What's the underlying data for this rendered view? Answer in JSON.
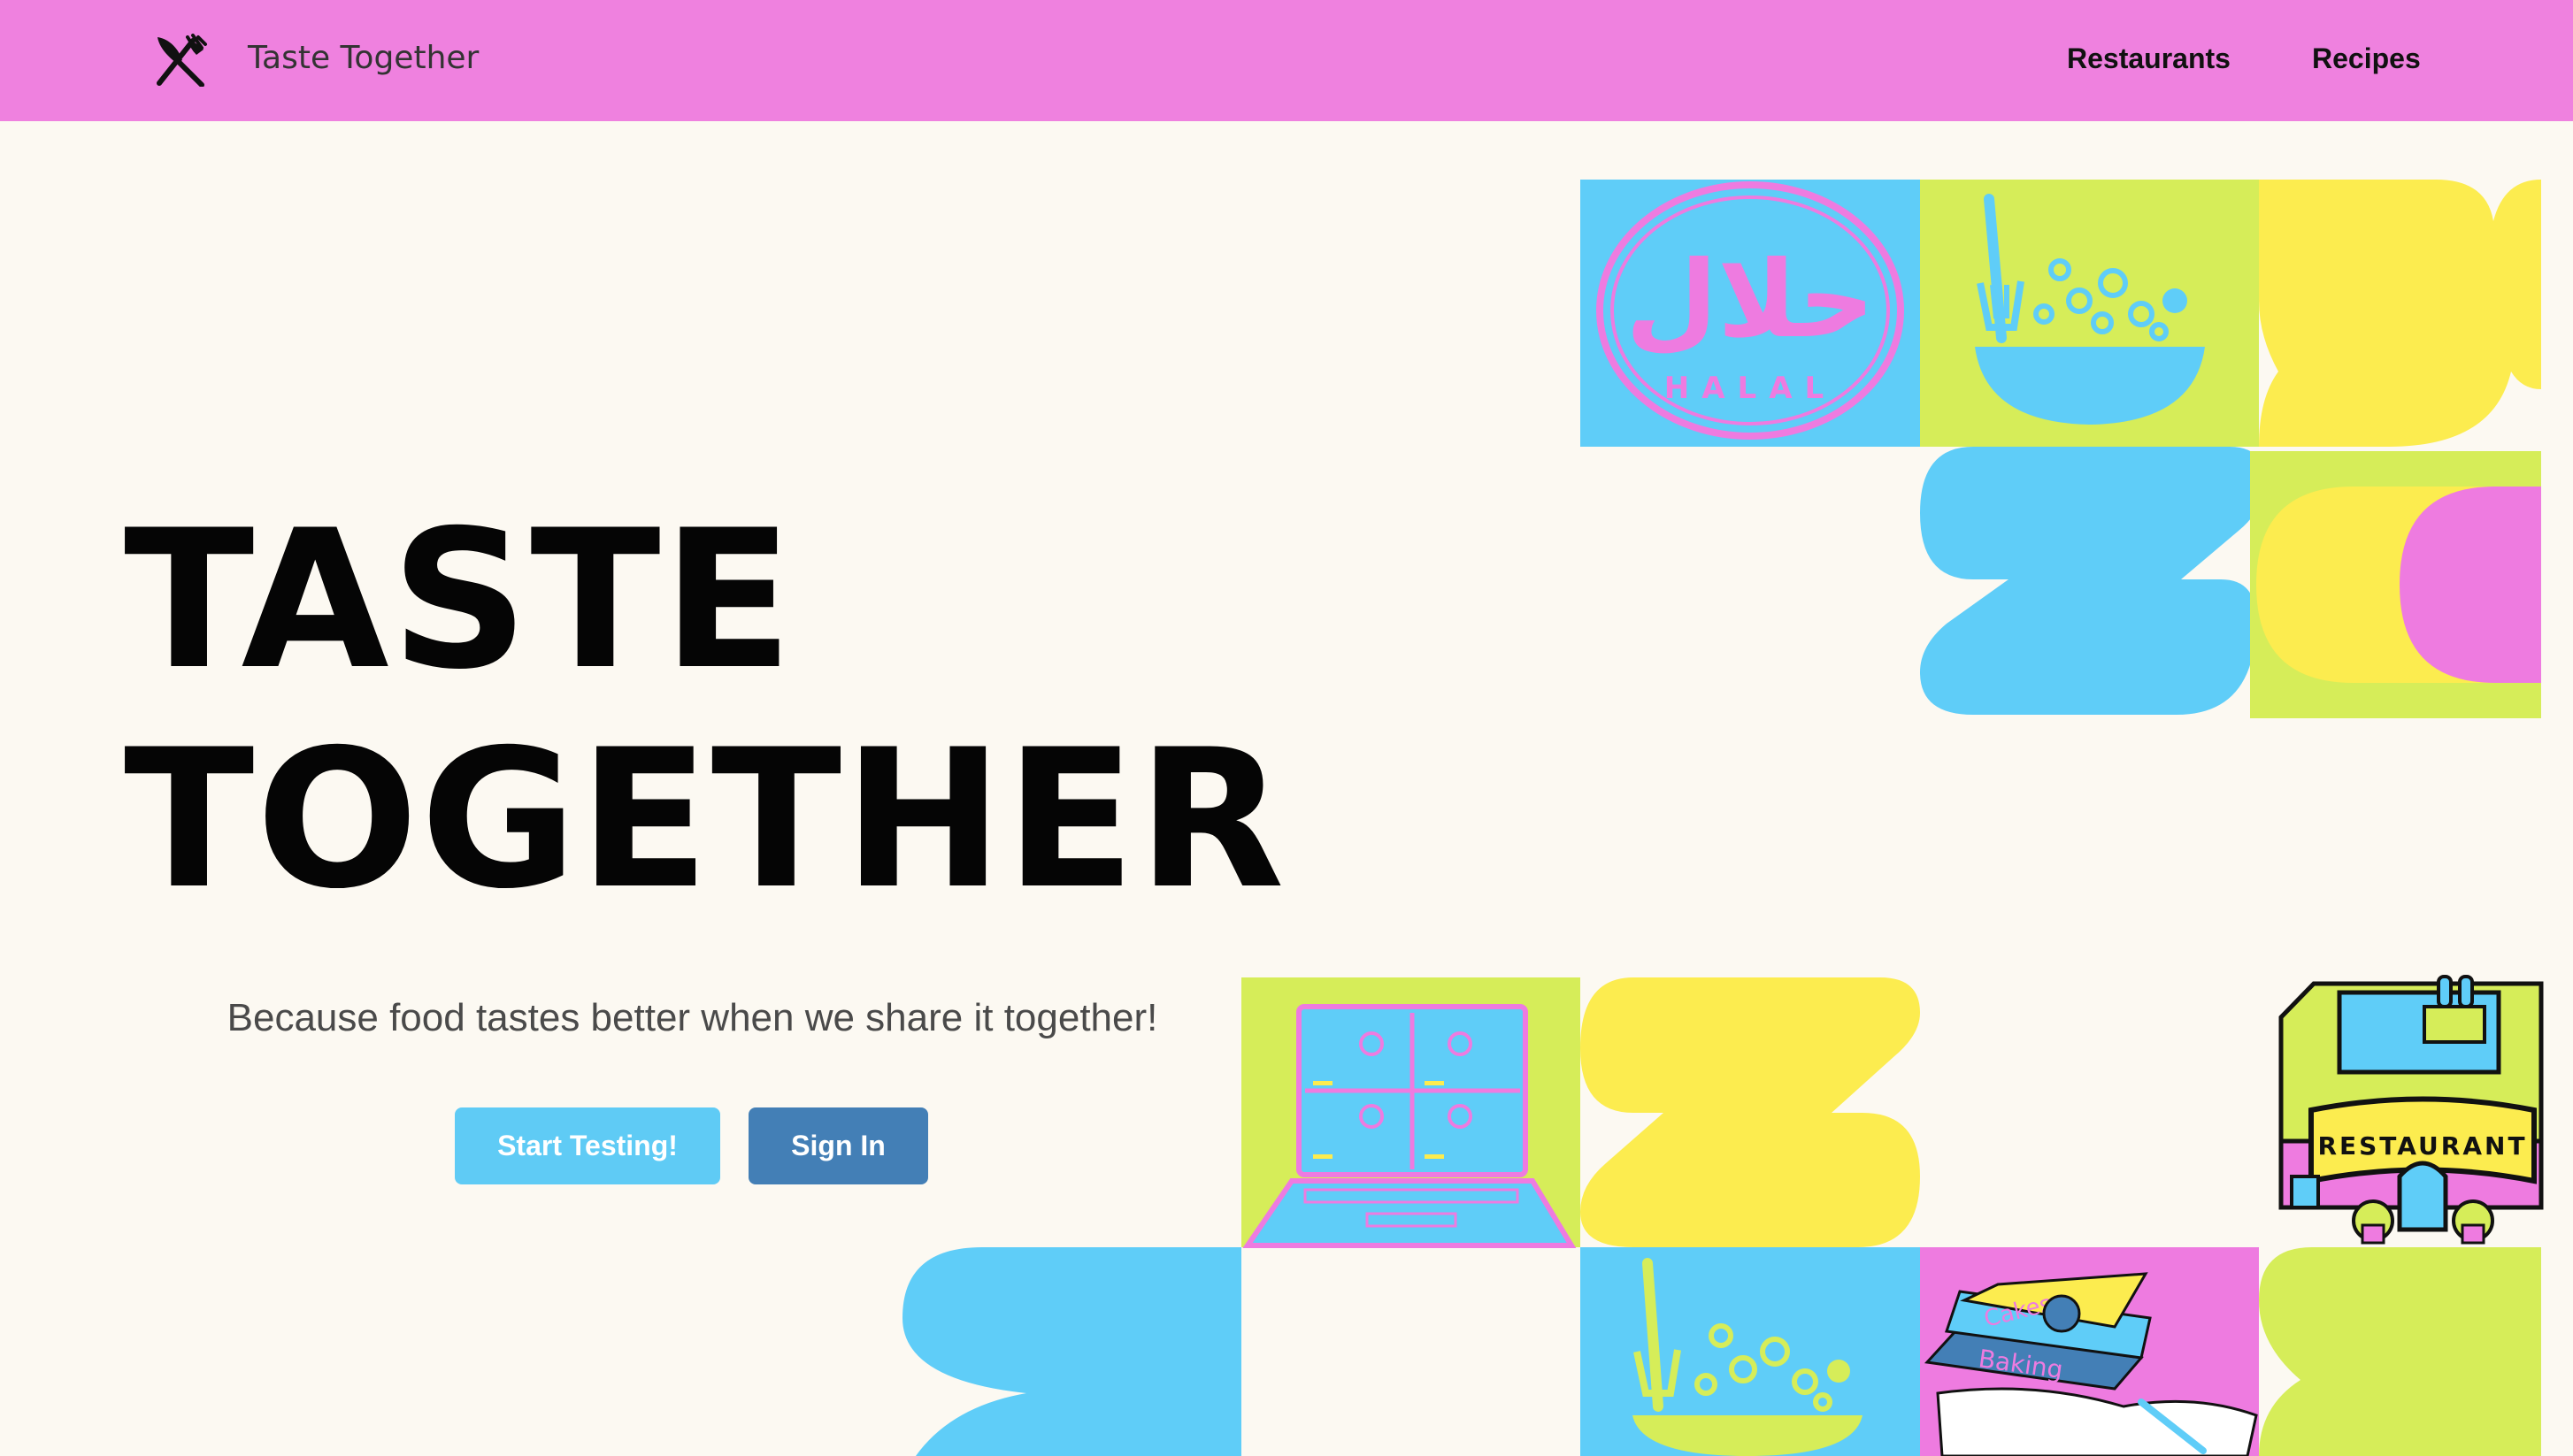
{
  "header": {
    "brand_icon": "fork-and-knife-icon",
    "brand_name": "Taste Together",
    "nav": [
      {
        "label": "Restaurants"
      },
      {
        "label": "Recipes"
      }
    ]
  },
  "hero": {
    "title_line1": "TASTE",
    "title_line2": "TOGETHER",
    "tagline": "Because food tastes better when we share it together!",
    "buttons": {
      "primary": "Start Testing!",
      "secondary": "Sign In"
    }
  },
  "illustrations": {
    "halal_arabic": "حلال",
    "halal_label": "HALAL",
    "restaurant_label": "RESTAURANT",
    "book_label_top": "Cakes",
    "book_label_bottom": "Baking"
  },
  "colors": {
    "nav_background": "#ef81df",
    "page_background": "#fcf9f2",
    "primary_button": "#5fcbf5",
    "secondary_button": "#437fb6",
    "tile_blue": "#5fcdf8",
    "tile_lime": "#d6ed59",
    "tile_yellow": "#fcec4f",
    "tile_pink": "#ee7be0"
  }
}
